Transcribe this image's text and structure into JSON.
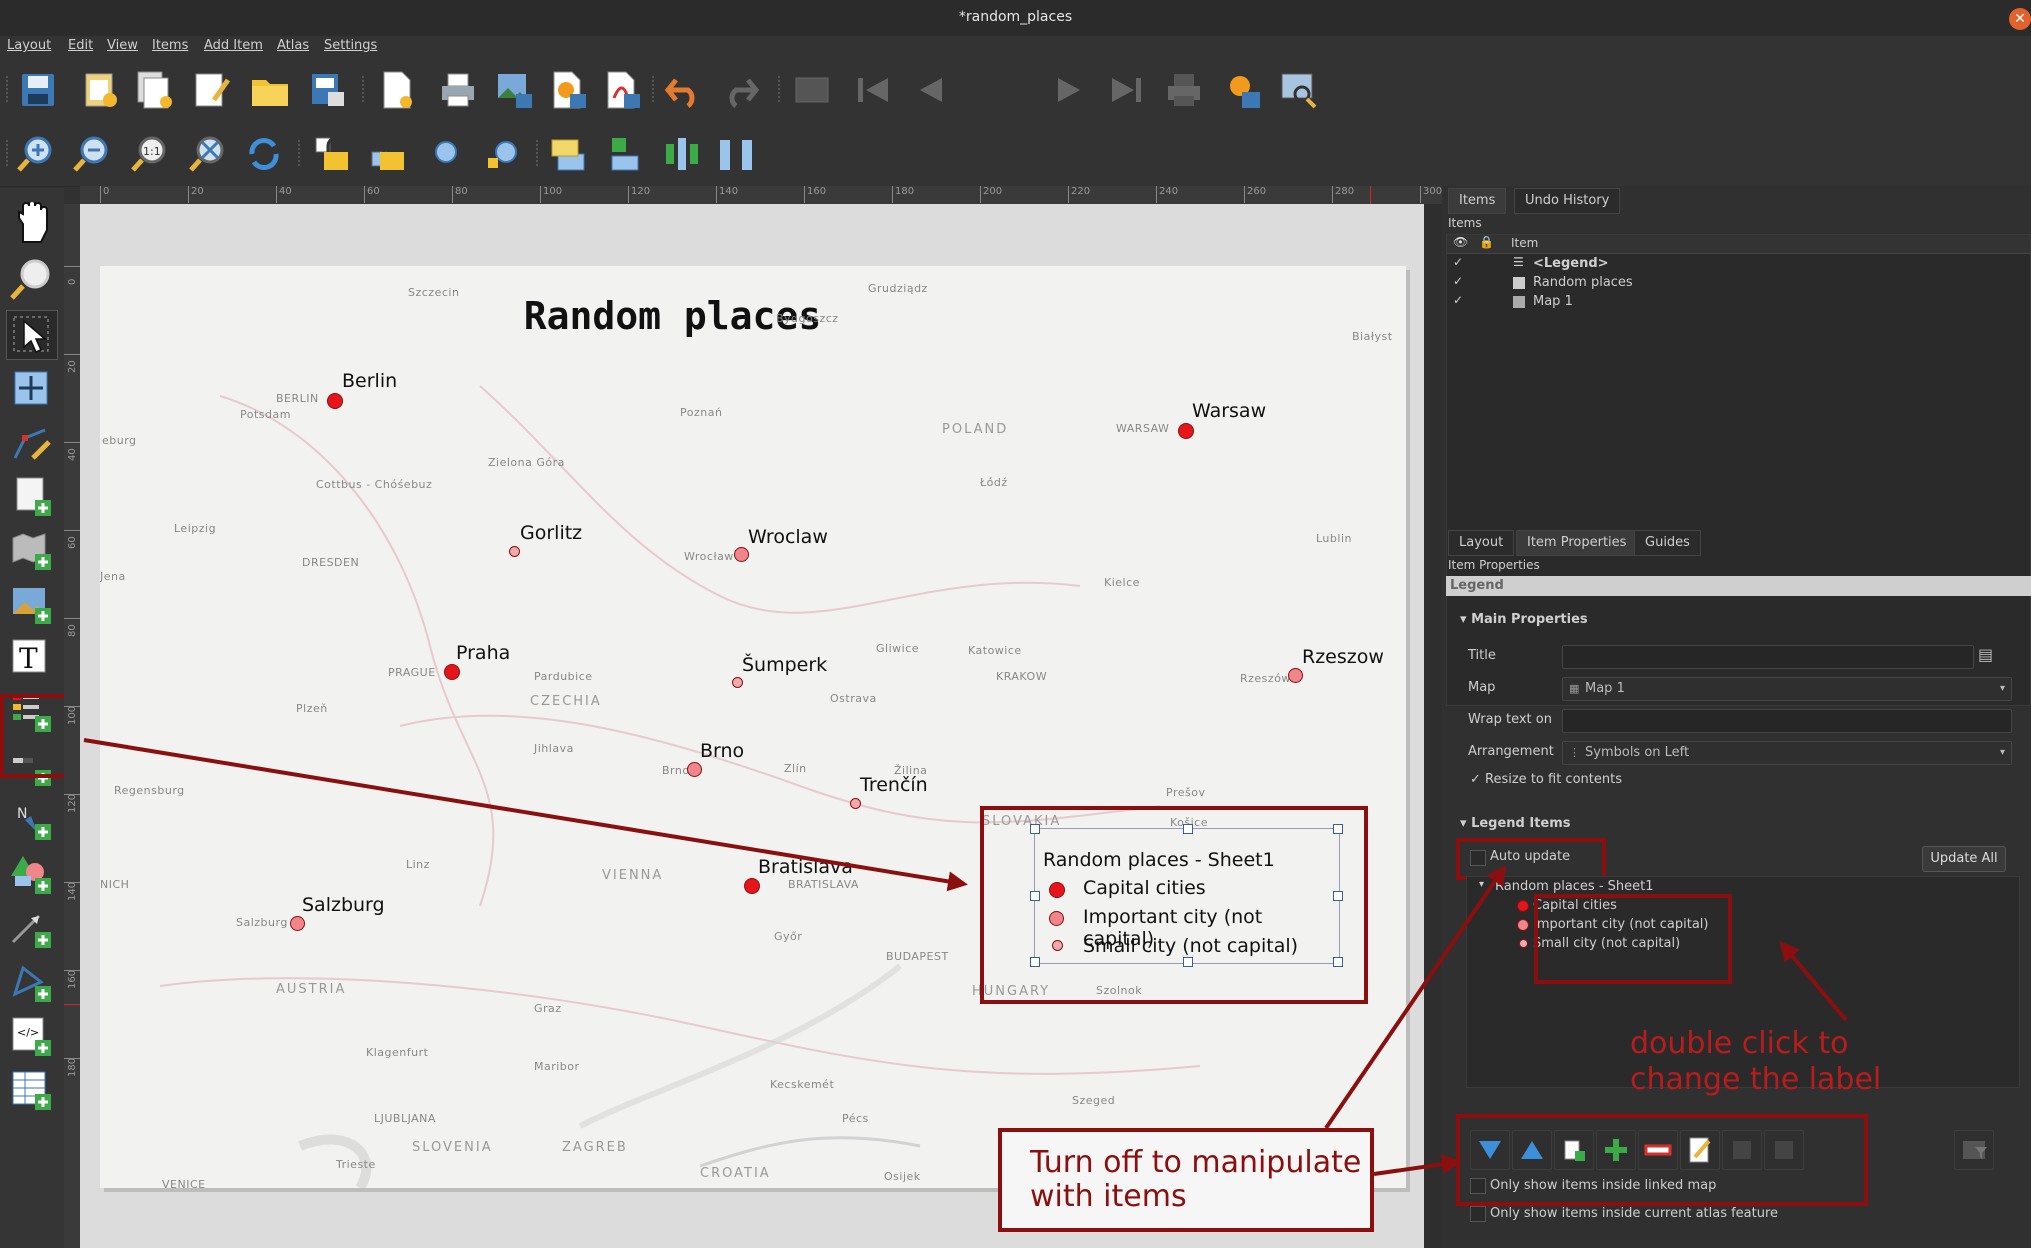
{
  "window": {
    "title": "*random_places"
  },
  "menu": [
    "Layout",
    "Edit",
    "View",
    "Items",
    "Add Item",
    "Atlas",
    "Settings"
  ],
  "toolbar": {
    "page_number": "1"
  },
  "ruler": {
    "h": [
      "0",
      "20",
      "40",
      "60",
      "80",
      "100",
      "120",
      "140",
      "160",
      "180",
      "200",
      "220",
      "240",
      "260",
      "280",
      "300"
    ],
    "v": [
      "0",
      "20",
      "40",
      "60",
      "80",
      "100",
      "120",
      "140",
      "160",
      "180"
    ]
  },
  "layout": {
    "title": "Random places",
    "cities": [
      {
        "name": "Berlin",
        "kind": "capital"
      },
      {
        "name": "Warsaw",
        "kind": "capital"
      },
      {
        "name": "Gorlitz",
        "kind": "small"
      },
      {
        "name": "Wroclaw",
        "kind": "important"
      },
      {
        "name": "Praha",
        "kind": "capital"
      },
      {
        "name": "Šumperk",
        "kind": "small"
      },
      {
        "name": "Rzeszow",
        "kind": "important"
      },
      {
        "name": "Brno",
        "kind": "important"
      },
      {
        "name": "Trenčín",
        "kind": "small"
      },
      {
        "name": "Bratislava",
        "kind": "capital"
      },
      {
        "name": "Salzburg",
        "kind": "important"
      }
    ],
    "basemap_labels": [
      "Szczecin",
      "Grudziądz",
      "Bydgoszcz",
      "Białyst",
      "BERLIN",
      "Potsdam",
      "eburg",
      "Poznań",
      "POLAND",
      "WARSAW",
      "Zielona Góra",
      "Łódź",
      "Cottbus - Chóśebuz",
      "Lublin",
      "Leipzig",
      "DRESDEN",
      "Wrocław",
      "Kielce",
      "Jena",
      "Pardubice",
      "Katowice",
      "Gliwice",
      "Rzeszów",
      "PRAGUE",
      "CZECHIA",
      "KRAKOW",
      "Plzeň",
      "Ostrava",
      "Jihlava",
      "Zlín",
      "Žilina",
      "Regensburg",
      "Brno",
      "Prešov",
      "SLOVAKIA",
      "Košice",
      "Linz",
      "VIENNA",
      "NICH",
      "BRATISLAVA",
      "Győr",
      "Salzburg",
      "BUDAPEST",
      "HUNGARY",
      "Szolnok",
      "AUSTRIA",
      "Graz",
      "Klagenfurt",
      "Maribor",
      "Kecskemét",
      "Szeged",
      "LJUBLJANA",
      "Pécs",
      "SLOVENIA",
      "ZAGREB",
      "CROATIA",
      "Osijek",
      "Trieste",
      "VENICE"
    ],
    "legend": {
      "title": "Random places - Sheet1",
      "items": [
        "Capital cities",
        "Important city (not capital)",
        "Small city (not capital)"
      ]
    }
  },
  "colors": {
    "capital": "#e8141c",
    "important": "#f0858a",
    "small": "#f2a9ae",
    "annotation": "#8b0f0f"
  },
  "dock": {
    "top_tabs": [
      "Items",
      "Undo History"
    ],
    "items_panel_title": "Items",
    "items_header": "Item",
    "items": [
      "<Legend>",
      "Random places",
      "Map 1"
    ],
    "bottom_tabs": [
      "Layout",
      "Item Properties",
      "Guides"
    ],
    "props_title": "Item Properties",
    "item_type": "Legend",
    "main_props": "Main Properties",
    "title_label": "Title",
    "title_value": "",
    "map_label": "Map",
    "map_value": "Map 1",
    "wrap_label": "Wrap text on",
    "wrap_value": "",
    "arrangement_label": "Arrangement",
    "arrangement_value": "Symbols on Left",
    "resize_label": "Resize to fit contents",
    "legend_items_header": "Legend Items",
    "auto_update": "Auto update",
    "update_all": "Update All",
    "tree_group": "Random places - Sheet1",
    "tree_items": [
      "Capital cities",
      "Important city (not capital)",
      "Small city (not capital)"
    ],
    "only_linked_map": "Only show items inside linked map",
    "only_atlas": "Only show items inside current atlas feature"
  },
  "annotations": {
    "double_click": [
      "double click to",
      "change the label"
    ],
    "turn_off": [
      "Turn off to manipulate",
      "with items"
    ]
  }
}
